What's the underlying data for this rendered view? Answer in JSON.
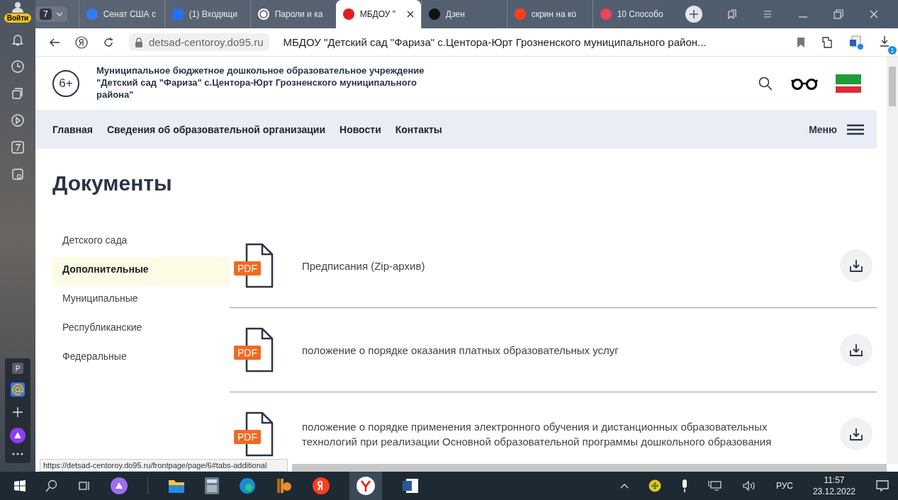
{
  "browser_sidebar": {
    "login_label": "Войти",
    "top_items": [
      {
        "kind": "bell"
      },
      {
        "kind": "clock"
      },
      {
        "kind": "collections"
      },
      {
        "kind": "play"
      },
      {
        "kind": "seven"
      },
      {
        "kind": "camera"
      }
    ],
    "bottom_items": [
      {
        "kind": "letter",
        "label": "P"
      },
      {
        "kind": "at"
      },
      {
        "kind": "plus"
      },
      {
        "kind": "alice"
      },
      {
        "kind": "dots"
      }
    ]
  },
  "tab_bar": {
    "tab_count": "7",
    "tabs": [
      {
        "label": "Сенат США с",
        "kind": "at",
        "selected": false
      },
      {
        "label": "(1) Входящи",
        "kind": "mail",
        "selected": false
      },
      {
        "label": "Пароли и ка",
        "kind": "smile",
        "selected": false
      },
      {
        "label": "МБДОУ \"",
        "kind": "yd",
        "selected": true
      },
      {
        "label": "Дзен",
        "kind": "zen",
        "selected": false
      },
      {
        "label": "скрин на ко",
        "kind": "ya",
        "selected": false
      },
      {
        "label": "10 Способо",
        "kind": "cursor",
        "selected": false
      }
    ]
  },
  "address_bar": {
    "domain": "detsad-centoroy.do95.ru",
    "page_title": "МБДОУ \"Детский сад \"Фариза\" с.Центора-Юрт Грозненского муниципального район...",
    "downloads_badge": "1"
  },
  "site": {
    "age_mark": "6+",
    "org_name": "Муниципальное бюджетное дошкольное образовательное учреждение \"Детский сад \"Фариза\" с.Центора-Юрт Грозненского муниципального района\"",
    "nav": [
      "Главная",
      "Сведения об образовательной организации",
      "Новости",
      "Контакты"
    ],
    "menu_label": "Меню",
    "heading": "Документы",
    "categories": [
      {
        "label": "Детского сада",
        "selected": false
      },
      {
        "label": "Дополнительные",
        "selected": true
      },
      {
        "label": "Муниципальные",
        "selected": false
      },
      {
        "label": "Республиканские",
        "selected": false
      },
      {
        "label": "Федеральные",
        "selected": false
      }
    ],
    "documents": [
      {
        "badge": "PDF",
        "title": "Предписания (Zip-архив)"
      },
      {
        "badge": "PDF",
        "title": "положение о порядке оказания платных образовательных услуг"
      },
      {
        "badge": "PDF",
        "title": "положение о порядке применения электронного обучения и дистанционных образовательных технологий при реализации Основной образовательной программы дошкольного образования"
      }
    ]
  },
  "status_url": "https://detsad-centoroy.do95.ru/frontpage/page/6#tabs-additional",
  "taskbar": {
    "language": "РУС",
    "time": "11:57",
    "date": "23.12.2022"
  }
}
